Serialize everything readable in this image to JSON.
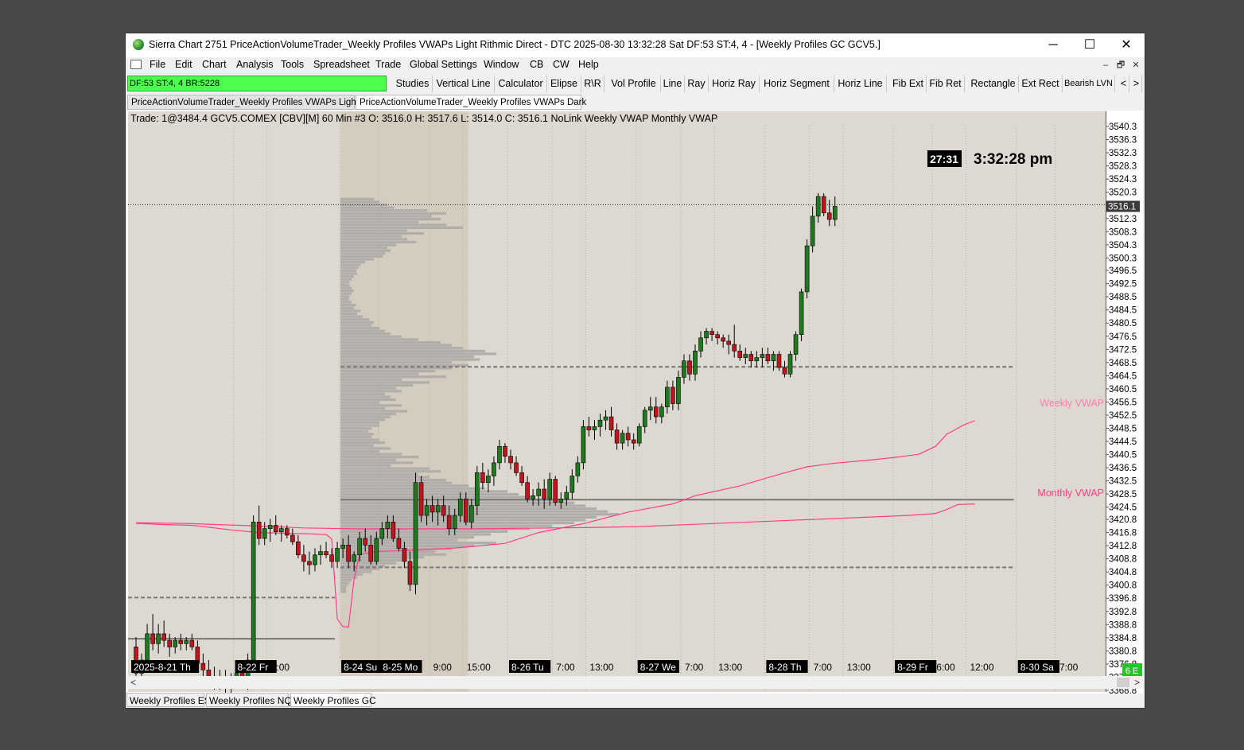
{
  "window": {
    "title": "Sierra Chart 2751 PriceActionVolumeTrader_Weekly Profiles VWAPs Light Rithmic Direct - DTC 2025-08-30  13:32:28 Sat DF:53  ST:4, 4 - [Weekly Profiles GC GCV5.]",
    "minimize": "─",
    "maximize": "☐",
    "close": "✕"
  },
  "menu": [
    "File",
    "Edit",
    "Chart",
    "Analysis",
    "Tools",
    "Spreadsheet",
    "Trade",
    "Global Settings",
    "Window",
    "CB",
    "CW",
    "Help"
  ],
  "mdi_buttons": [
    "–",
    "🗗",
    "✕"
  ],
  "status": "DF:53  ST:4, 4  BR:5228",
  "toolbar": [
    "Studies",
    "Vertical Line",
    "Calculator",
    "Elipse",
    "R\\R",
    "Vol Profile",
    "Line",
    "Ray",
    "Horiz Ray",
    "Horiz Segment",
    "Horiz Line",
    "Fib Ext",
    "Fib Ret",
    "Rectangle",
    "Ext Rect",
    "Bearish LVN",
    "<",
    ">"
  ],
  "chart_tabs": [
    "PriceActionVolumeTrader_Weekly Profiles VWAPs Light",
    "PriceActionVolumeTrader_Weekly Profiles VWAPs Dark"
  ],
  "chart_header": "Trade: 1@3484.4  GCV5.COMEX [CBV][M]  60 Min  #3 O: 3516.0  H: 3517.6  L: 3514.0  C: 3516.1  NoLink  Weekly VWAP   Monthly VWAP",
  "timer": "27:31",
  "clock": "3:32:28 pm",
  "price_label": "3516.1",
  "vwap_labels": {
    "weekly": "Weekly VWAP",
    "monthly": "Monthly VWAP"
  },
  "corner_label": "6 E",
  "bottom_tabs": [
    "Weekly Profiles ES",
    "Weekly Profiles NQ",
    "Weekly Profiles GC"
  ],
  "colors": {
    "up": "#1f7a1f",
    "down": "#c0141e",
    "vwap": "#ff3d8a",
    "chart_bg": "#ddd9d1",
    "profile": "#b0adaa"
  },
  "chart_data": {
    "type": "candlestick",
    "symbol": "GCV5.COMEX",
    "interval": "60 Min",
    "ylim": [
      3368.8,
      3542
    ],
    "y_ticks": [
      3540.3,
      3536.3,
      3532.3,
      3528.3,
      3524.3,
      3520.3,
      3516.3,
      3512.3,
      3508.3,
      3504.3,
      3500.3,
      3496.5,
      3492.5,
      3488.5,
      3484.5,
      3480.5,
      3476.5,
      3472.5,
      3468.5,
      3464.5,
      3460.5,
      3456.5,
      3452.5,
      3448.5,
      3444.5,
      3440.5,
      3436.5,
      3432.5,
      3428.5,
      3424.5,
      3420.8,
      3416.8,
      3412.8,
      3408.8,
      3404.8,
      3400.8,
      3396.8,
      3392.8,
      3388.8,
      3384.8,
      3380.8,
      3376.8,
      3372.8,
      3368.8
    ],
    "x_labels": [
      {
        "text": "2025-8-21 Th",
        "bar": 0,
        "boxed": true
      },
      {
        "text": "8-22 Fr",
        "bar": 18,
        "boxed": true
      },
      {
        "text": "6:00",
        "bar": 24,
        "boxed": false
      },
      {
        "text": "8-24 Su",
        "bar": 37,
        "boxed": true
      },
      {
        "text": "8-25 Mo",
        "bar": 44,
        "boxed": true
      },
      {
        "text": "9:00",
        "bar": 53,
        "boxed": false
      },
      {
        "text": "15:00",
        "bar": 59,
        "boxed": false
      },
      {
        "text": "8-26 Tu",
        "bar": 67,
        "boxed": true
      },
      {
        "text": "7:00",
        "bar": 75,
        "boxed": false
      },
      {
        "text": "13:00",
        "bar": 81,
        "boxed": false
      },
      {
        "text": "8-27 We",
        "bar": 90,
        "boxed": true
      },
      {
        "text": "7:00",
        "bar": 98,
        "boxed": false
      },
      {
        "text": "13:00",
        "bar": 104,
        "boxed": false
      },
      {
        "text": "8-28 Th",
        "bar": 113,
        "boxed": true
      },
      {
        "text": "7:00",
        "bar": 121,
        "boxed": false
      },
      {
        "text": "13:00",
        "bar": 127,
        "boxed": false
      },
      {
        "text": "8-29 Fr",
        "bar": 136,
        "boxed": true
      },
      {
        "text": "6:00",
        "bar": 143,
        "boxed": false
      },
      {
        "text": "12:00",
        "bar": 149,
        "boxed": false
      },
      {
        "text": "8-30 Sa",
        "bar": 158,
        "boxed": true
      },
      {
        "text": "7:00",
        "bar": 165,
        "boxed": false
      }
    ],
    "candles": [
      [
        3382,
        3385,
        3370,
        3374
      ],
      [
        3374,
        3380,
        3371,
        3378
      ],
      [
        3378,
        3389,
        3376,
        3386
      ],
      [
        3386,
        3392,
        3381,
        3383
      ],
      [
        3383,
        3389,
        3380,
        3386
      ],
      [
        3386,
        3390,
        3382,
        3384
      ],
      [
        3384,
        3386,
        3379,
        3382
      ],
      [
        3382,
        3385,
        3380,
        3384
      ],
      [
        3384,
        3386,
        3381,
        3383
      ],
      [
        3383,
        3385,
        3381,
        3384
      ],
      [
        3384,
        3386,
        3381,
        3382
      ],
      [
        3382,
        3384,
        3375,
        3377
      ],
      [
        3377,
        3380,
        3373,
        3375
      ],
      [
        3375,
        3378,
        3371,
        3373
      ],
      [
        3373,
        3376,
        3369,
        3372
      ],
      [
        3372,
        3375,
        3369,
        3373
      ],
      [
        3373,
        3375,
        3368,
        3370
      ],
      [
        3370,
        3374,
        3368,
        3373
      ],
      [
        3373,
        3376,
        3371,
        3374
      ],
      [
        3374,
        3376,
        3370,
        3371
      ],
      [
        3371,
        3380,
        3369,
        3378
      ],
      [
        3378,
        3422,
        3376,
        3420
      ],
      [
        3420,
        3425,
        3413,
        3415
      ],
      [
        3415,
        3420,
        3413,
        3418
      ],
      [
        3418,
        3421,
        3414,
        3419
      ],
      [
        3419,
        3422,
        3416,
        3417
      ],
      [
        3417,
        3419,
        3414,
        3418
      ],
      [
        3418,
        3419,
        3415,
        3416
      ],
      [
        3416,
        3418,
        3413,
        3414
      ],
      [
        3414,
        3416,
        3409,
        3410
      ],
      [
        3410,
        3413,
        3405,
        3408
      ],
      [
        3408,
        3411,
        3404,
        3407
      ],
      [
        3407,
        3412,
        3405,
        3410
      ],
      [
        3410,
        3413,
        3407,
        3411
      ],
      [
        3411,
        3414,
        3409,
        3410
      ],
      [
        3410,
        3412,
        3406,
        3408
      ],
      [
        3408,
        3414,
        3406,
        3412
      ],
      [
        3412,
        3415,
        3409,
        3413
      ],
      [
        3413,
        3416,
        3406,
        3408
      ],
      [
        3408,
        3411,
        3405,
        3410
      ],
      [
        3410,
        3417,
        3408,
        3415
      ],
      [
        3415,
        3418,
        3411,
        3413
      ],
      [
        3413,
        3416,
        3407,
        3408
      ],
      [
        3408,
        3417,
        3407,
        3415
      ],
      [
        3415,
        3420,
        3413,
        3418
      ],
      [
        3418,
        3422,
        3415,
        3420
      ],
      [
        3420,
        3422,
        3414,
        3415
      ],
      [
        3415,
        3418,
        3411,
        3412
      ],
      [
        3412,
        3414,
        3406,
        3408
      ],
      [
        3408,
        3411,
        3399,
        3401
      ],
      [
        3401,
        3435,
        3398,
        3432
      ],
      [
        3432,
        3434,
        3420,
        3422
      ],
      [
        3422,
        3427,
        3419,
        3425
      ],
      [
        3425,
        3428,
        3420,
        3423
      ],
      [
        3423,
        3427,
        3419,
        3425
      ],
      [
        3425,
        3428,
        3420,
        3422
      ],
      [
        3422,
        3425,
        3416,
        3418
      ],
      [
        3418,
        3424,
        3416,
        3422
      ],
      [
        3422,
        3429,
        3420,
        3427
      ],
      [
        3427,
        3429,
        3419,
        3420
      ],
      [
        3420,
        3427,
        3418,
        3425
      ],
      [
        3425,
        3437,
        3422,
        3435
      ],
      [
        3435,
        3438,
        3430,
        3432
      ],
      [
        3432,
        3436,
        3429,
        3434
      ],
      [
        3434,
        3440,
        3431,
        3438
      ],
      [
        3438,
        3445,
        3436,
        3443
      ],
      [
        3443,
        3444,
        3438,
        3440
      ],
      [
        3440,
        3442,
        3436,
        3438
      ],
      [
        3438,
        3440,
        3434,
        3435
      ],
      [
        3435,
        3437,
        3431,
        3432
      ],
      [
        3432,
        3434,
        3426,
        3427
      ],
      [
        3427,
        3430,
        3425,
        3428
      ],
      [
        3428,
        3432,
        3425,
        3430
      ],
      [
        3430,
        3433,
        3424,
        3427
      ],
      [
        3427,
        3435,
        3425,
        3433
      ],
      [
        3433,
        3434,
        3425,
        3426
      ],
      [
        3426,
        3429,
        3424,
        3427
      ],
      [
        3427,
        3431,
        3425,
        3429
      ],
      [
        3429,
        3436,
        3427,
        3434
      ],
      [
        3434,
        3440,
        3432,
        3438
      ],
      [
        3438,
        3451,
        3436,
        3449
      ],
      [
        3449,
        3452,
        3446,
        3448
      ],
      [
        3448,
        3451,
        3445,
        3449
      ],
      [
        3449,
        3453,
        3446,
        3451
      ],
      [
        3451,
        3454,
        3448,
        3452
      ],
      [
        3452,
        3455,
        3446,
        3448
      ],
      [
        3448,
        3450,
        3442,
        3444
      ],
      [
        3444,
        3448,
        3442,
        3447
      ],
      [
        3447,
        3449,
        3443,
        3445
      ],
      [
        3445,
        3447,
        3442,
        3444
      ],
      [
        3444,
        3450,
        3443,
        3449
      ],
      [
        3449,
        3455,
        3447,
        3454
      ],
      [
        3454,
        3458,
        3451,
        3455
      ],
      [
        3455,
        3458,
        3450,
        3452
      ],
      [
        3452,
        3456,
        3450,
        3455
      ],
      [
        3455,
        3463,
        3453,
        3461
      ],
      [
        3461,
        3463,
        3454,
        3456
      ],
      [
        3456,
        3466,
        3454,
        3464
      ],
      [
        3464,
        3471,
        3462,
        3469
      ],
      [
        3469,
        3471,
        3463,
        3465
      ],
      [
        3465,
        3474,
        3463,
        3472
      ],
      [
        3472,
        3478,
        3470,
        3476
      ],
      [
        3476,
        3479,
        3474,
        3478
      ],
      [
        3478,
        3479,
        3475,
        3477
      ],
      [
        3477,
        3478,
        3474,
        3476
      ],
      [
        3476,
        3477,
        3473,
        3475
      ],
      [
        3475,
        3477,
        3471,
        3474
      ],
      [
        3474,
        3480,
        3470,
        3472
      ],
      [
        3472,
        3474,
        3469,
        3470
      ],
      [
        3470,
        3473,
        3468,
        3471
      ],
      [
        3471,
        3472,
        3467,
        3469
      ],
      [
        3469,
        3472,
        3467,
        3470
      ],
      [
        3470,
        3473,
        3467,
        3471
      ],
      [
        3471,
        3473,
        3468,
        3469
      ],
      [
        3469,
        3472,
        3466,
        3471
      ],
      [
        3471,
        3472,
        3466,
        3467
      ],
      [
        3467,
        3469,
        3464,
        3465
      ],
      [
        3465,
        3472,
        3464,
        3471
      ],
      [
        3471,
        3478,
        3469,
        3477
      ],
      [
        3477,
        3491,
        3475,
        3490
      ],
      [
        3490,
        3506,
        3488,
        3504
      ],
      [
        3504,
        3516,
        3502,
        3513
      ],
      [
        3513,
        3520,
        3511,
        3519
      ],
      [
        3519,
        3520,
        3513,
        3514
      ],
      [
        3514,
        3518,
        3510,
        3512
      ],
      [
        3512,
        3519,
        3510,
        3516
      ]
    ],
    "weekly_vwap": [
      [
        0,
        3419.6
      ],
      [
        5,
        3419.2
      ],
      [
        10,
        3419.0
      ],
      [
        13,
        3418.4
      ],
      [
        17,
        3417.6
      ],
      [
        22,
        3416.8
      ],
      [
        26,
        3416.6
      ],
      [
        31,
        3416.4
      ],
      [
        34,
        3416.2
      ],
      [
        35,
        3414.8
      ],
      [
        36,
        3390.5
      ],
      [
        37,
        3388.2
      ],
      [
        38,
        3388.0
      ],
      [
        39,
        3402.7
      ],
      [
        40,
        3410.2
      ],
      [
        43,
        3411.0
      ],
      [
        50,
        3411.5
      ],
      [
        58,
        3412.2
      ],
      [
        66,
        3413.5
      ],
      [
        72,
        3416.8
      ],
      [
        80,
        3419.5
      ],
      [
        88,
        3423.0
      ],
      [
        96,
        3425.5
      ],
      [
        100,
        3428.0
      ],
      [
        108,
        3431.0
      ],
      [
        115,
        3434.5
      ],
      [
        120,
        3436.8
      ],
      [
        125,
        3437.9
      ],
      [
        131,
        3438.8
      ],
      [
        136,
        3439.7
      ],
      [
        140,
        3440.6
      ],
      [
        143,
        3443.0
      ],
      [
        145,
        3446.7
      ],
      [
        148,
        3449.5
      ],
      [
        150,
        3450.8
      ]
    ],
    "monthly_vwap": [
      [
        0,
        3419.8
      ],
      [
        10,
        3419.5
      ],
      [
        20,
        3418.9
      ],
      [
        30,
        3418.2
      ],
      [
        40,
        3417.9
      ],
      [
        50,
        3417.9
      ],
      [
        60,
        3417.9
      ],
      [
        70,
        3418.1
      ],
      [
        80,
        3418.3
      ],
      [
        90,
        3418.6
      ],
      [
        100,
        3419.3
      ],
      [
        110,
        3420.0
      ],
      [
        120,
        3420.7
      ],
      [
        130,
        3421.4
      ],
      [
        138,
        3422.0
      ],
      [
        143,
        3422.6
      ],
      [
        145,
        3423.8
      ],
      [
        147,
        3425.3
      ],
      [
        150,
        3425.5
      ]
    ],
    "horizontal_levels": [
      {
        "price": 3467.2,
        "from_bar": 37,
        "style": "dashed"
      },
      {
        "price": 3426.8,
        "from_bar": 37,
        "style": "solid"
      },
      {
        "price": 3406.2,
        "from_bar": 37,
        "style": "dashed"
      },
      {
        "price": 3397.0,
        "from_bar": 0,
        "to_bar": 35,
        "style": "dashed"
      },
      {
        "price": 3384.5,
        "from_bar": 0,
        "to_bar": 35,
        "style": "solid"
      },
      {
        "price": 3370.5,
        "from_bar": 0,
        "to_bar": 35,
        "style": "dashed"
      },
      {
        "price": 3516.5,
        "from_bar": 0,
        "style": "dotted"
      }
    ],
    "volume_profile": {
      "start_bar": 37,
      "price_high": 3518.6,
      "price_low": 3398.3,
      "row_lengths": [
        0.3,
        0.35,
        0.42,
        0.48,
        0.78,
        0.95,
        0.82,
        0.9,
        0.7,
        0.95,
        1.1,
        0.6,
        0.75,
        0.55,
        0.6,
        0.68,
        0.5,
        0.42,
        0.45,
        0.4,
        0.38,
        0.3,
        0.22,
        0.18,
        0.16,
        0.14,
        0.15,
        0.12,
        0.1,
        0.08,
        0.08,
        0.1,
        0.12,
        0.1,
        0.08,
        0.08,
        0.1,
        0.14,
        0.12,
        0.18,
        0.15,
        0.2,
        0.26,
        0.3,
        0.28,
        0.35,
        0.4,
        0.45,
        0.55,
        0.7,
        0.9,
        1.0,
        1.1,
        1.3,
        1.4,
        1.2,
        1.25,
        1.0,
        1.15,
        1.0,
        0.85,
        0.7,
        0.95,
        0.55,
        0.8,
        0.65,
        0.5,
        0.55,
        0.4,
        0.45,
        0.5,
        0.35,
        0.55,
        0.4,
        0.6,
        0.5,
        0.45,
        0.4,
        0.35,
        0.35,
        0.28,
        0.25,
        0.3,
        0.28,
        0.35,
        0.4,
        0.3,
        0.45,
        0.35,
        0.55,
        0.7,
        0.5,
        0.65,
        0.45,
        0.8,
        0.9,
        0.7,
        0.8,
        0.95,
        1.0,
        1.15,
        1.3,
        1.5,
        1.6,
        1.75,
        1.9,
        2.1,
        2.2,
        2.3,
        2.4,
        2.5,
        2.3,
        2.2,
        2.1,
        1.9,
        1.7,
        1.5,
        1.35,
        1.2,
        1.05,
        1.4,
        1.2,
        1.0,
        0.85,
        0.95,
        0.75,
        0.6,
        0.5,
        0.4,
        0.35,
        0.28,
        0.2,
        0.15,
        0.1,
        0.08,
        0.06,
        0.05,
        0.05
      ]
    }
  }
}
